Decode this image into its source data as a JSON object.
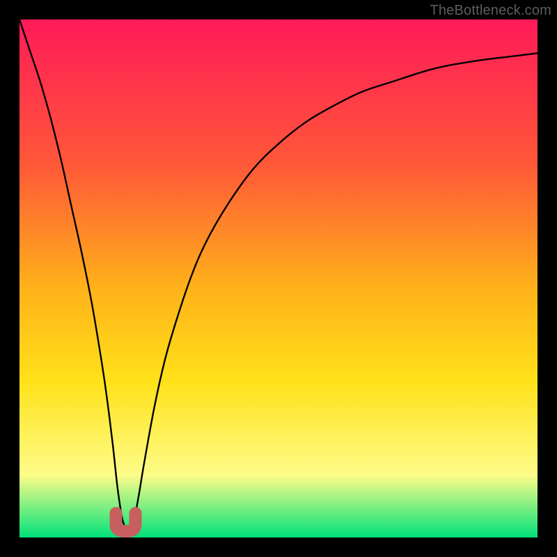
{
  "watermark": "TheBottleneck.com",
  "colors": {
    "frame": "#000000",
    "grad_top": "#ff1a59",
    "grad_mid1": "#ff5838",
    "grad_mid2": "#ffb21a",
    "grad_mid3": "#ffe21a",
    "grad_mid4": "#fdfc89",
    "grad_bottom": "#00e27a",
    "curve": "#000000",
    "marker": "#c75f5f"
  },
  "chart_data": {
    "type": "line",
    "title": "",
    "xlabel": "",
    "ylabel": "",
    "xlim": [
      0,
      100
    ],
    "ylim": [
      0,
      100
    ],
    "grid": false,
    "legend": false,
    "annotations": [],
    "series": [
      {
        "name": "bottleneck-curve",
        "x": [
          0,
          2,
          4,
          6,
          8,
          10,
          12,
          14,
          16,
          17,
          18,
          19,
          20,
          21,
          22,
          23,
          24,
          26,
          28,
          30,
          33,
          36,
          40,
          45,
          50,
          55,
          60,
          66,
          72,
          80,
          88,
          96,
          100
        ],
        "y": [
          100,
          94,
          88,
          81,
          73,
          64,
          55,
          45,
          33,
          26,
          18,
          9,
          3,
          2,
          3,
          8,
          14,
          25,
          34,
          41,
          50,
          57,
          64,
          71,
          76,
          80,
          83,
          86,
          88,
          90.5,
          92,
          93,
          93.5
        ]
      }
    ],
    "marker": {
      "x": 20.5,
      "y": 2,
      "shape": "U",
      "color": "#c75f5f"
    }
  }
}
